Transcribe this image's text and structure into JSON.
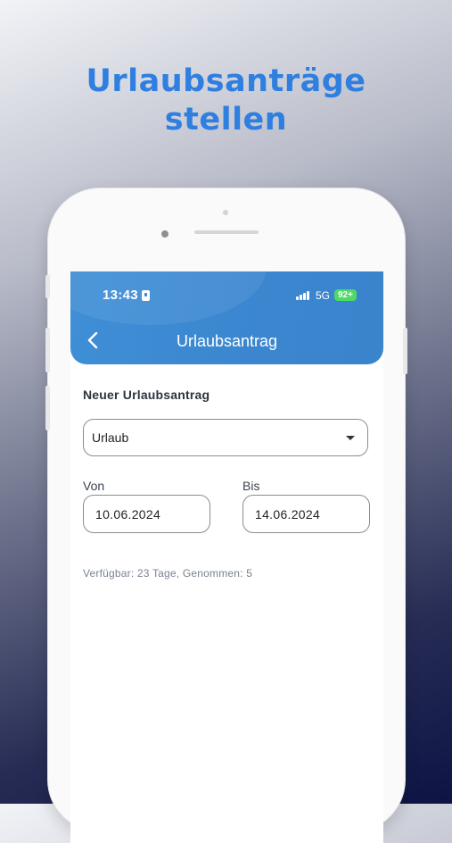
{
  "promo": {
    "headline_line1": "Urlaubsanträge",
    "headline_line2": "stellen",
    "accent_color": "#2f7fe0"
  },
  "status_bar": {
    "time": "13:43",
    "network": "5G",
    "battery": "92+",
    "icons": [
      "lock-icon",
      "signal-icon",
      "battery-icon"
    ]
  },
  "app_bar": {
    "title": "Urlaubsantrag",
    "back_icon": "chevron-left-icon",
    "color": "#3b86cf"
  },
  "form": {
    "heading": "Neuer Urlaubsantrag",
    "type_select": {
      "value": "Urlaub",
      "icon": "dropdown-arrow-icon"
    },
    "from": {
      "label": "Von",
      "value": "10.06.2024"
    },
    "to": {
      "label": "Bis",
      "value": "14.06.2024"
    },
    "availability": "Verfügbar: 23 Tage, Genommen: 5"
  }
}
